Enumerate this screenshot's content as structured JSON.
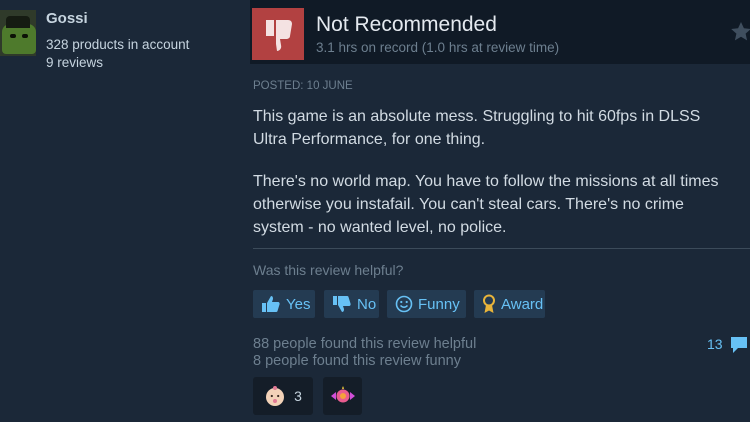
{
  "user": {
    "name": "Gossi",
    "products": "328 products in account",
    "reviews": "9 reviews"
  },
  "review": {
    "verdict": "Not Recommended",
    "hours": "3.1 hrs on record (1.0 hrs at review time)",
    "posted": "POSTED: 10 JUNE",
    "body": [
      "This game is an absolute mess. Struggling to hit 60fps in DLSS Ultra Performance, for one thing.",
      "There's no world map. You have to follow the missions at all times otherwise you instafail. You can't steal cars. There's no crime system - no wanted level, no police."
    ]
  },
  "helpful": {
    "question": "Was this review helpful?",
    "buttons": {
      "yes": "Yes",
      "no": "No",
      "funny": "Funny",
      "award": "Award"
    },
    "found_helpful": "88 people found this review helpful",
    "found_funny": "8 people found this review funny",
    "comments": "13"
  },
  "awards": [
    {
      "icon": "baby-face-award-icon",
      "count": "3"
    },
    {
      "icon": "candy-award-icon",
      "count": ""
    }
  ],
  "colors": {
    "background": "#1b2838",
    "header": "#101a26",
    "not_recommended": "#b24141",
    "link": "#67c1f5",
    "button_bg": "#243b52"
  }
}
